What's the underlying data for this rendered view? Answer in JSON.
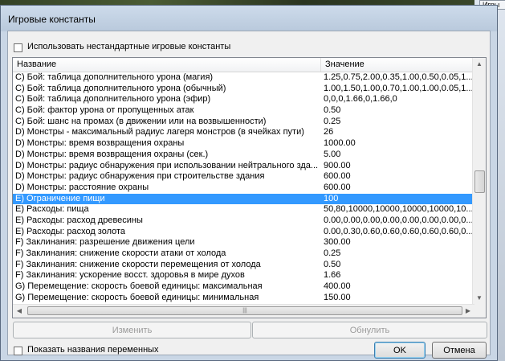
{
  "window": {
    "title": "Игровые константы"
  },
  "background": {
    "tab_label": "Игры"
  },
  "options": {
    "use_custom_label": "Использовать нестандартные игровые константы",
    "use_custom_checked": false
  },
  "table": {
    "columns": [
      "Название",
      "Значение"
    ],
    "selected_index": 11,
    "rows": [
      {
        "name": "C) Бой: таблица дополнительного урона (магия)",
        "value": "1.25,0.75,2.00,0.35,1.00,0.50,0.05,1..."
      },
      {
        "name": "C) Бой: таблица дополнительного урона (обычный)",
        "value": "1.00,1.50,1.00,0.70,1.00,1.00,0.05,1..."
      },
      {
        "name": "C) Бой: таблица дополнительного урона (эфир)",
        "value": "0,0,0,1.66,0,1.66,0"
      },
      {
        "name": "C) Бой: фактор урона от пропущенных атак",
        "value": "0.50"
      },
      {
        "name": "C) Бой: шанс на промах (в движении или на возвышенности)",
        "value": "0.25"
      },
      {
        "name": "D) Монстры - максимальный радиус лагеря монстров (в ячейках пути)",
        "value": "26"
      },
      {
        "name": "D) Монстры: время возвращения охраны",
        "value": "1000.00"
      },
      {
        "name": "D) Монстры: время возвращения охраны (сек.)",
        "value": "5.00"
      },
      {
        "name": "D) Монстры: радиус обнаружения при использовании нейтрального зда...",
        "value": "900.00"
      },
      {
        "name": "D) Монстры: радиус обнаружения при строительстве здания",
        "value": "600.00"
      },
      {
        "name": "D) Монстры: расстояние охраны",
        "value": "600.00"
      },
      {
        "name": "E) Ограничение пищи",
        "value": "100"
      },
      {
        "name": "E) Расходы: пища",
        "value": "50,80,10000,10000,10000,10000,10..."
      },
      {
        "name": "E) Расходы: расход древесины",
        "value": "0.00,0.00,0.00,0.00,0.00,0.00,0.00,0..."
      },
      {
        "name": "E) Расходы: расход золота",
        "value": "0.00,0.30,0.60,0.60,0.60,0.60,0.60,0..."
      },
      {
        "name": "F) Заклинания: разрешение движения цели",
        "value": "300.00"
      },
      {
        "name": "F) Заклинания: снижение скорости атаки от холода",
        "value": "0.25"
      },
      {
        "name": "F) Заклинания: снижение скорости перемещения от холода",
        "value": "0.50"
      },
      {
        "name": "F) Заклинания: ускорение восст. здоровья в мире духов",
        "value": "1.66"
      },
      {
        "name": "G) Перемещение: скорость боевой единицы: максимальная",
        "value": "400.00"
      },
      {
        "name": "G) Перемещение: скорость боевой единицы: минимальная",
        "value": "150.00"
      }
    ]
  },
  "buttons": {
    "edit": "Изменить",
    "reset": "Обнулить",
    "ok": "OK",
    "cancel": "Отмена"
  },
  "footer": {
    "show_names_label": "Показать названия переменных",
    "show_names_checked": false
  },
  "colors": {
    "selection": "#3399ff",
    "window_frame": "#c9d6e5"
  }
}
